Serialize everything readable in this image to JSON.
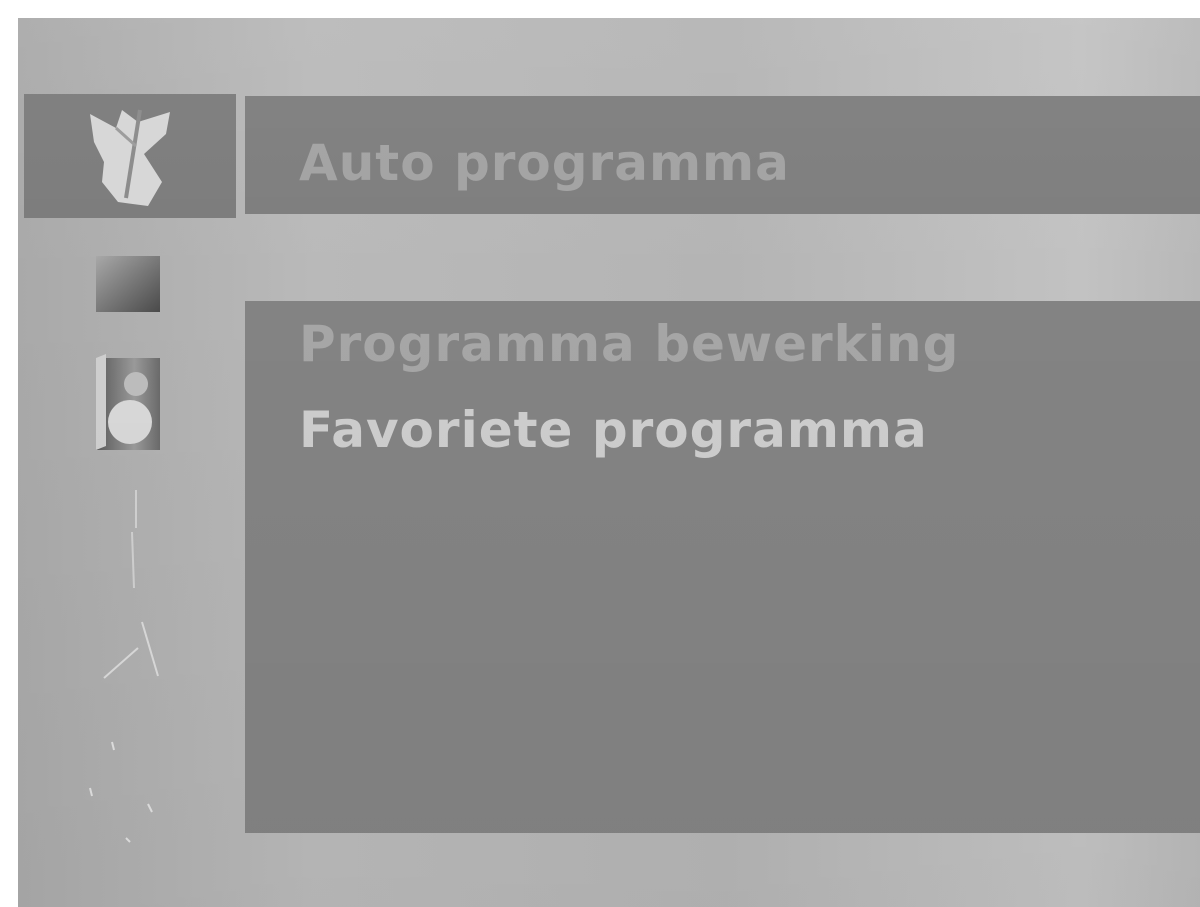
{
  "menu": {
    "selected_index": 0,
    "items": [
      {
        "label": "Auto programma",
        "icon": "station-setup-icon",
        "selected": true
      },
      {
        "label": "Programma bewerking",
        "icon": "picture-icon",
        "selected": false
      },
      {
        "label": "Favoriete programma",
        "icon": "sound-icon",
        "selected": false
      }
    ]
  },
  "sidebar": {
    "icons": [
      "station-setup-icon",
      "picture-icon",
      "sound-icon",
      "time-icon",
      "special-icon",
      "screen-icon"
    ]
  },
  "colors": {
    "background": "#b4b4b4",
    "panel": "#838383",
    "selected_panel": "#7b7b7b",
    "text_highlight": "#cdcdcd",
    "text_dim": "#a4a4a4"
  }
}
